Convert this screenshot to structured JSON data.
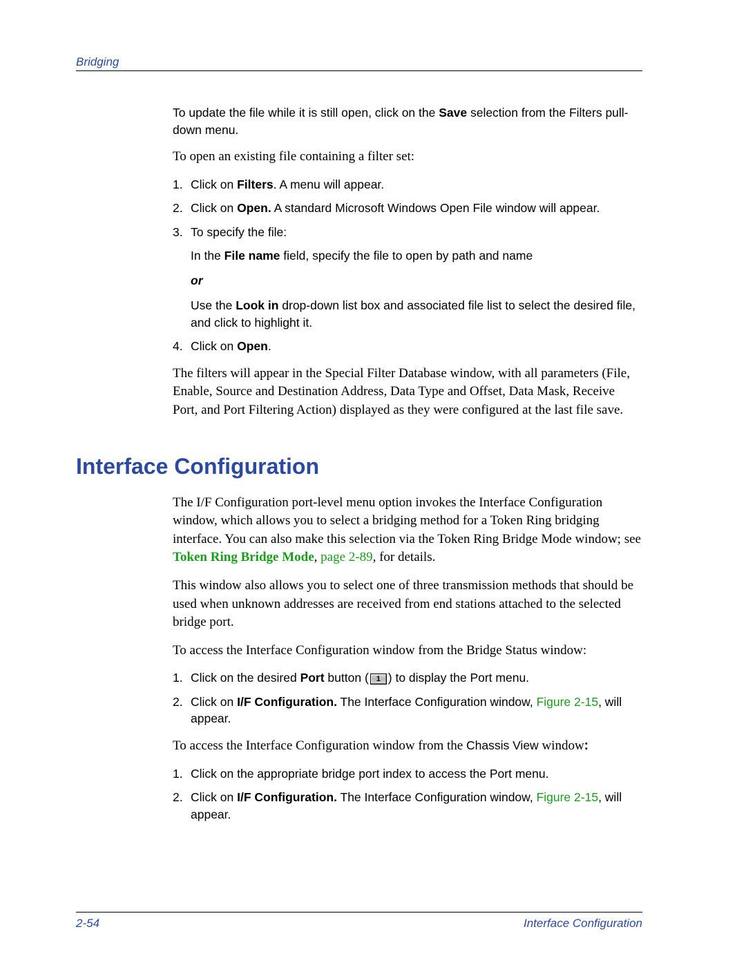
{
  "header": {
    "chapter": "Bridging"
  },
  "intro": {
    "p1_a": "To update the file while it is still open, click on the ",
    "p1_b": "Save",
    "p1_c": " selection from the Filters pull-down menu.",
    "p2": "To open an existing file containing a filter set:"
  },
  "steps1": {
    "s1_a": "Click on ",
    "s1_b": "Filters",
    "s1_c": ". A menu will appear.",
    "s2_a": "Click on ",
    "s2_b": "Open.",
    "s2_c": " A standard Microsoft Windows Open File window will appear.",
    "s3": "To specify the file:",
    "s3_sub1_a": "In the ",
    "s3_sub1_b": "File name",
    "s3_sub1_c": " field, specify the file to open by path and name",
    "or": "or",
    "s3_sub2_a": "Use the ",
    "s3_sub2_b": "Look in",
    "s3_sub2_c": " drop-down list box and associated file list to select the desired file, and click to highlight it.",
    "s4_a": "Click on ",
    "s4_b": "Open",
    "s4_c": ".",
    "after": "The filters will appear in the Special Filter Database window, with all parameters (File, Enable, Source and Destination Address, Data Type and Offset, Data Mask, Receive Port, and Port Filtering Action) displayed as they were configured at the last file save."
  },
  "section": {
    "title": "Interface Configuration",
    "p1_a": "The I/F Configuration port-level menu option invokes the Interface Configuration window, which allows you to select a bridging method for a Token Ring bridging interface. You can also make this selection via the Token Ring Bridge Mode window; see ",
    "p1_link": "Token Ring Bridge Mode",
    "p1_b": ", ",
    "p1_page": "page 2-89",
    "p1_c": ", for details.",
    "p2": "This window also allows you to select one of three transmission methods that should be used when unknown addresses are received from end stations attached to the selected bridge port.",
    "p3": "To access the Interface Configuration window from the Bridge Status window:"
  },
  "steps2": {
    "s1_a": "Click on the desired ",
    "s1_b": "Port",
    "s1_c": " button (",
    "s1_icon": "1",
    "s1_d": ") to display the Port menu.",
    "s2_a": "Click on ",
    "s2_b": "I/F Configuration.",
    "s2_c": " The Interface Configuration window, ",
    "s2_link": "Figure 2-15",
    "s2_d": ", will appear."
  },
  "p4_a": "To access the Interface Configuration window from the ",
  "p4_b": "Chassis View",
  "p4_c": " window",
  "p4_colon": ":",
  "steps3": {
    "s1": "Click on the appropriate bridge port index to access the Port menu.",
    "s2_a": "Click on ",
    "s2_b": "I/F Configuration.",
    "s2_c": " The Interface Configuration window, ",
    "s2_link": "Figure 2-15",
    "s2_d": ", will appear."
  },
  "footer": {
    "page": "2-54",
    "section": "Interface Configuration"
  }
}
